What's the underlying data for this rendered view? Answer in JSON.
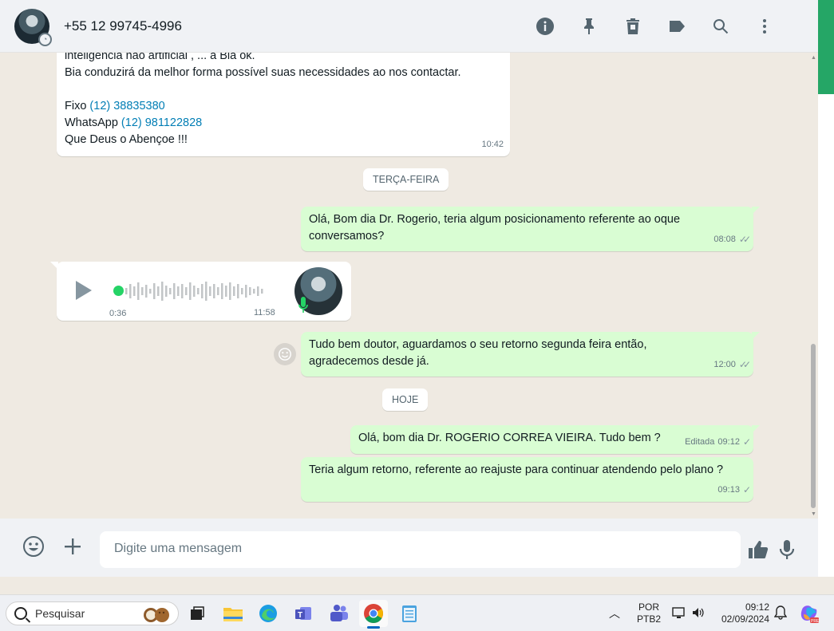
{
  "header": {
    "contact_name": "+55 12 99745-4996",
    "icons": [
      "info-icon",
      "pin-icon",
      "clear-chat-icon",
      "label-icon",
      "search-icon",
      "menu-icon"
    ]
  },
  "messages": {
    "m1": {
      "line1": "inteligência não artificial , ... a Bia ok.",
      "line2": "Bia conduzirá da melhor forma possível suas  necessidades  ao nos contactar.",
      "fixo_label": "Fixo ",
      "fixo_number": "(12) 38835380",
      "whats_label": "WhatsApp ",
      "whats_number": "(12) 981122828",
      "line5": "Que Deus o Abençoe !!!",
      "time": "10:42"
    },
    "day1": "TERÇA-FEIRA",
    "m2": {
      "text": "Olá, Bom dia Dr. Rogerio, teria algum posicionamento referente ao oque conversamos?",
      "time": "08:08"
    },
    "voice": {
      "duration": "0:36",
      "time": "11:58"
    },
    "m3": {
      "text": "Tudo bem doutor, aguardamos o seu retorno segunda feira então, agradecemos desde já.",
      "time": "12:00"
    },
    "day2": "HOJE",
    "m4": {
      "text": "Olá, bom dia Dr. ROGERIO CORREA VIEIRA. Tudo bem ?",
      "edited": "Editada",
      "time": "09:12"
    },
    "m5": {
      "text": "Teria algum retorno, referente ao reajuste para continuar atendendo pelo plano ?",
      "time": "09:13"
    }
  },
  "composer": {
    "placeholder": "Digite uma mensagem"
  },
  "taskbar": {
    "search_label": "Pesquisar",
    "lang_top": "POR",
    "lang_bottom": "PTB2",
    "clock_time": "09:12",
    "clock_date": "02/09/2024"
  },
  "colors": {
    "incoming": "#ffffff",
    "outgoing": "#d9fdd3",
    "background": "#efeae2",
    "link": "#027eb5",
    "accent": "#25d366"
  }
}
